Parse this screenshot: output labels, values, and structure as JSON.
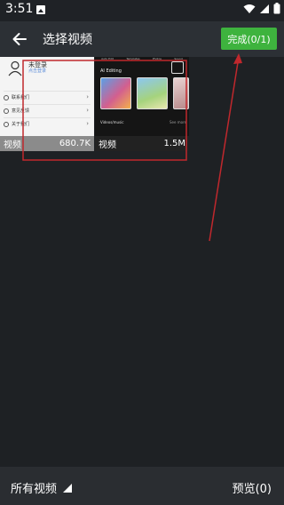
{
  "status_bar": {
    "time": "3:51",
    "icons": [
      "image-icon",
      "wifi-icon",
      "signal-icon",
      "battery-icon"
    ]
  },
  "app_bar": {
    "back_icon": "back-arrow-icon",
    "title": "选择视频",
    "done_label": "完成(0/1)"
  },
  "grid": {
    "items": [
      {
        "type_label": "视频",
        "size": "680.7K",
        "thumbnail": {
          "login_text": "未登录",
          "sub_text": "点击登录",
          "rows": [
            "联系我们",
            "意见反馈",
            "关于我们"
          ]
        }
      },
      {
        "type_label": "视频",
        "size": "1.5M",
        "thumbnail": {
          "tabs": [
            "Auto Edit",
            "Templates",
            "Photos",
            "Sound"
          ],
          "section_title": "AI Editing",
          "subtitle": "Videos/music",
          "right_text": "See more"
        }
      }
    ]
  },
  "bottom_bar": {
    "album_label": "所有视频",
    "preview_label": "预览(0)"
  },
  "colors": {
    "background": "#1e2124",
    "app_bar": "#2c3035",
    "accent_green": "#3eb33e",
    "annotation_red": "#c0282d"
  }
}
